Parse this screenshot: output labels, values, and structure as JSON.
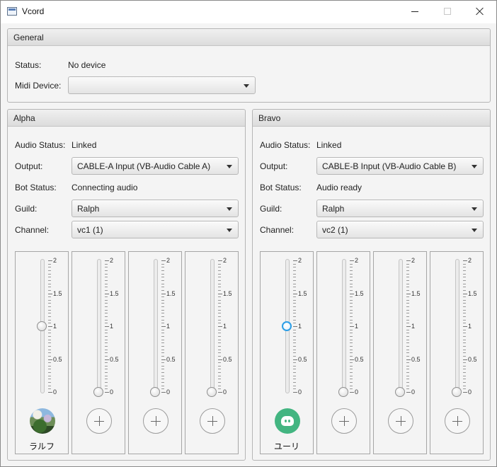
{
  "window": {
    "title": "Vcord",
    "controls": [
      "minimize",
      "maximize",
      "close"
    ]
  },
  "general": {
    "title": "General",
    "status_label": "Status:",
    "status_value": "No device",
    "midi_label": "Midi Device:",
    "midi_value": ""
  },
  "alpha": {
    "title": "Alpha",
    "audio_status_label": "Audio Status:",
    "audio_status": "Linked",
    "output_label": "Output:",
    "output": "CABLE-A Input (VB-Audio Cable A)",
    "bot_status_label": "Bot Status:",
    "bot_status": "Connecting audio",
    "guild_label": "Guild:",
    "guild": "Ralph",
    "channel_label": "Channel:",
    "channel": "vc1 (1)",
    "strips": [
      {
        "name": "ラルフ",
        "volume": 1,
        "avatar": "photo-avatar",
        "focused": false
      },
      {
        "name": "",
        "volume": 0,
        "avatar": "add-icon",
        "focused": false
      },
      {
        "name": "",
        "volume": 0,
        "avatar": "add-icon",
        "focused": false
      },
      {
        "name": "",
        "volume": 0,
        "avatar": "add-icon",
        "focused": false
      }
    ]
  },
  "bravo": {
    "title": "Bravo",
    "audio_status_label": "Audio Status:",
    "audio_status": "Linked",
    "output_label": "Output:",
    "output": "CABLE-B Input (VB-Audio Cable B)",
    "bot_status_label": "Bot Status:",
    "bot_status": "Audio ready",
    "guild_label": "Guild:",
    "guild": "Ralph",
    "channel_label": "Channel:",
    "channel": "vc2 (1)",
    "strips": [
      {
        "name": "ユーリ",
        "volume": 1,
        "avatar": "discord-avatar",
        "focused": true
      },
      {
        "name": "",
        "volume": 0,
        "avatar": "add-icon",
        "focused": false
      },
      {
        "name": "",
        "volume": 0,
        "avatar": "add-icon",
        "focused": false
      },
      {
        "name": "",
        "volume": 0,
        "avatar": "add-icon",
        "focused": false
      }
    ]
  },
  "slider_scale": {
    "max": 2,
    "labels": [
      "2",
      "1.5",
      "1",
      "0.5",
      "0"
    ]
  }
}
